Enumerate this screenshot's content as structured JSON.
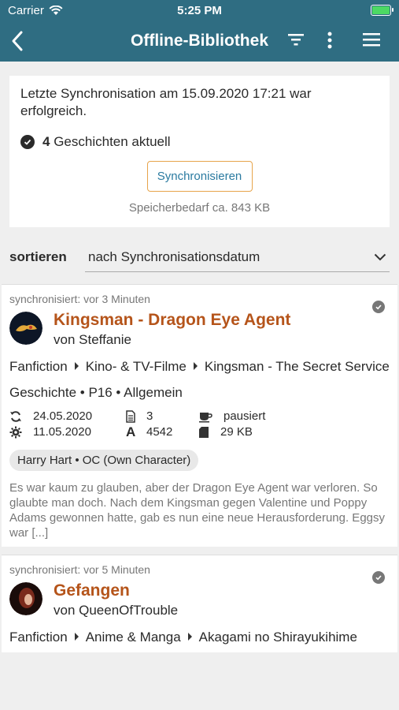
{
  "status_bar": {
    "carrier": "Carrier",
    "time": "5:25 PM"
  },
  "nav": {
    "title": "Offline-Bibliothek"
  },
  "sync": {
    "message": "Letzte Synchronisation am 15.09.2020 17:21 war erfolgreich.",
    "count": "4",
    "count_label": "Geschichten aktuell",
    "button": "Synchronisieren",
    "storage": "Speicherbedarf ca. 843 KB"
  },
  "sort": {
    "label": "sortieren",
    "value": "nach Synchronisationsdatum"
  },
  "stories": [
    {
      "synced": "synchronisiert: vor 3 Minuten",
      "title": "Kingsman - Dragon Eye Agent",
      "author": "von Steffanie",
      "crumbs": [
        "Fanfiction",
        "Kino- & TV-Filme",
        "Kingsman - The Secret Service"
      ],
      "meta": "Geschichte • P16 • Allgemein",
      "updated": "24.05.2020",
      "created": "11.05.2020",
      "chapters": "3",
      "words": "4542",
      "state": "pausiert",
      "size": "29 KB",
      "tags": "Harry Hart  •  OC (Own Character)",
      "summary": "Es war kaum zu glauben, aber der Dragon Eye Agent war verloren. So glaubte man doch. Nach dem Kingsman gegen Valentine und Poppy Adams gewonnen hatte, gab es nun eine neue Herausforderung. Eggsy war [...]"
    },
    {
      "synced": "synchronisiert: vor 5 Minuten",
      "title": "Gefangen",
      "author": "von QueenOfTrouble",
      "crumbs": [
        "Fanfiction",
        "Anime & Manga",
        "Akagami no Shirayukihime"
      ]
    }
  ]
}
